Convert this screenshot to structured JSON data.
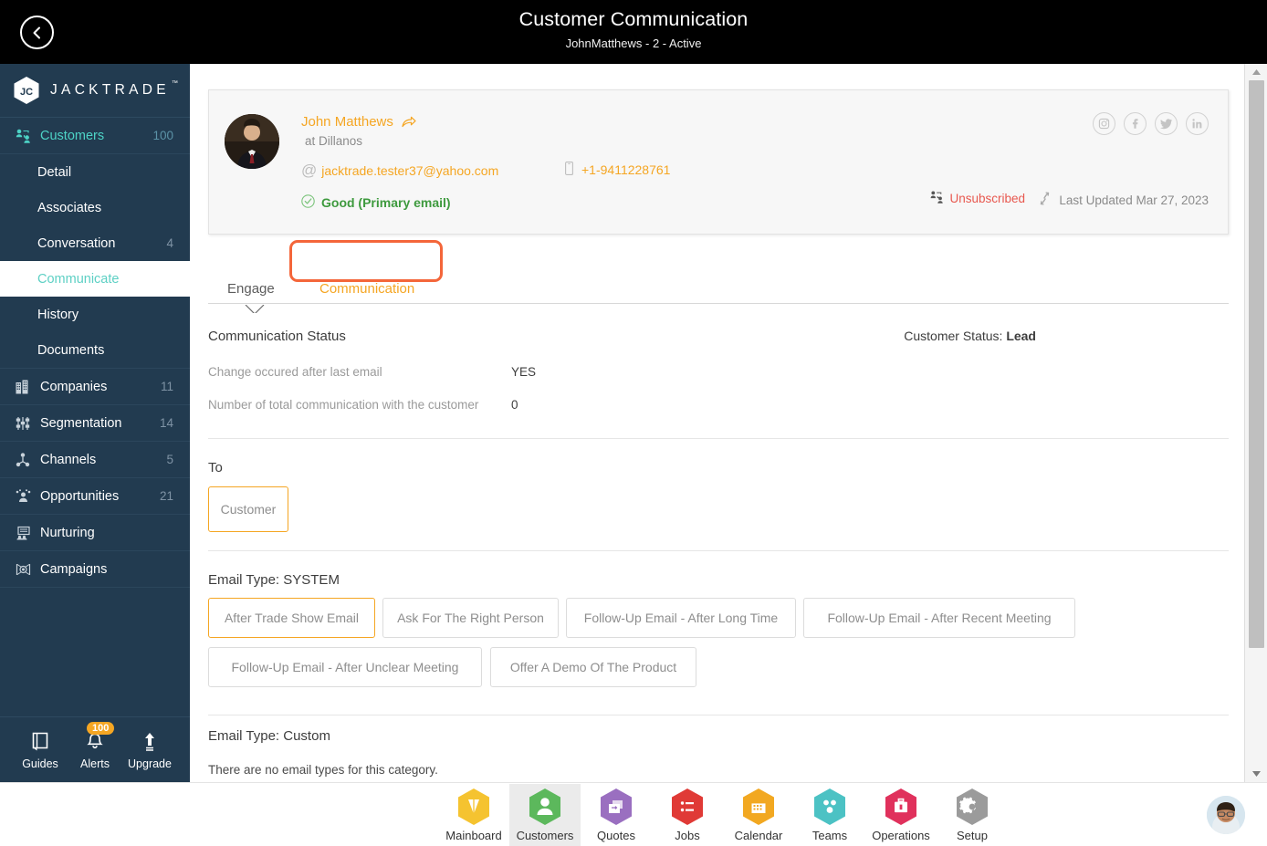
{
  "header": {
    "title": "Customer Communication",
    "subtitle": "JohnMatthews - 2 - Active",
    "back_icon": "back-arrow-circle-icon"
  },
  "sidebar": {
    "brand": "JACKTRADE",
    "brand_tm": "™",
    "nav": [
      {
        "label": "Customers",
        "count": "100",
        "icon": "customers-icon",
        "accent": true
      },
      {
        "label": "Companies",
        "count": "11",
        "icon": "companies-icon",
        "accent": false
      },
      {
        "label": "Segmentation",
        "count": "14",
        "icon": "segmentation-icon",
        "accent": false
      },
      {
        "label": "Channels",
        "count": "5",
        "icon": "channels-icon",
        "accent": false
      },
      {
        "label": "Opportunities",
        "count": "21",
        "icon": "opportunities-icon",
        "accent": false
      },
      {
        "label": "Nurturing",
        "count": "",
        "icon": "nurturing-icon",
        "accent": false
      },
      {
        "label": "Campaigns",
        "count": "",
        "icon": "campaigns-icon",
        "accent": false
      }
    ],
    "sub": [
      {
        "label": "Detail",
        "count": ""
      },
      {
        "label": "Associates",
        "count": ""
      },
      {
        "label": "Conversation",
        "count": "4"
      },
      {
        "label": "Communicate",
        "count": ""
      },
      {
        "label": "History",
        "count": ""
      },
      {
        "label": "Documents",
        "count": ""
      }
    ],
    "tools": [
      {
        "label": "Guides",
        "icon": "book-icon",
        "badge": ""
      },
      {
        "label": "Alerts",
        "icon": "bell-icon",
        "badge": "100"
      },
      {
        "label": "Upgrade",
        "icon": "up-arrow-icon",
        "badge": ""
      }
    ],
    "quick_icons": [
      "person-hex-icon",
      "dollar-hex-icon",
      "payment-hex-icon",
      "workflow-hex-icon"
    ]
  },
  "profile": {
    "name": "John Matthews",
    "company": "at Dillanos",
    "email": "jacktrade.tester37@yahoo.com",
    "phone": "+1-9411228761",
    "email_status": "Good (Primary email)",
    "unsubscribed": "Unsubscribed",
    "last_updated": "Last Updated Mar 27, 2023",
    "socials": [
      {
        "name": "instagram-icon",
        "glyph": "▣"
      },
      {
        "name": "facebook-icon",
        "glyph": "f"
      },
      {
        "name": "twitter-icon",
        "glyph": "ᵥ"
      },
      {
        "name": "linkedin-icon",
        "glyph": "in"
      }
    ]
  },
  "tabs": {
    "engage": "Engage",
    "communication": "Communication",
    "active": "Engage",
    "annotated": "Communication"
  },
  "comm_status": {
    "heading": "Communication Status",
    "customer_status_label": "Customer Status:",
    "customer_status_value": "Lead",
    "rows": [
      {
        "key": "Change occured after last email",
        "value": "YES"
      },
      {
        "key": "Number of total communication with the customer",
        "value": "0"
      }
    ]
  },
  "to_section": {
    "label": "To",
    "option": "Customer"
  },
  "email_system": {
    "heading": "Email Type: SYSTEM",
    "options": [
      {
        "label": "After Trade Show Email",
        "selected": true
      },
      {
        "label": "Ask For The Right Person",
        "selected": false
      },
      {
        "label": "Follow-Up Email - After Long Time",
        "selected": false
      },
      {
        "label": "Follow-Up Email - After Recent Meeting",
        "selected": false
      },
      {
        "label": "Follow-Up Email - After Unclear Meeting",
        "selected": false
      },
      {
        "label": "Offer A Demo Of The Product",
        "selected": false
      }
    ]
  },
  "email_custom": {
    "heading": "Email Type: Custom",
    "empty": "There are no email types for this category."
  },
  "bottom_nav": [
    {
      "label": "Mainboard",
      "color": "#f5c330",
      "icon": "mainboard-icon",
      "active": false
    },
    {
      "label": "Customers",
      "color": "#5cb85c",
      "icon": "customers-icon",
      "active": true
    },
    {
      "label": "Quotes",
      "color": "#9a6fc0",
      "icon": "quotes-icon",
      "active": false
    },
    {
      "label": "Jobs",
      "color": "#e03a36",
      "icon": "jobs-icon",
      "active": false
    },
    {
      "label": "Calendar",
      "color": "#f2a821",
      "icon": "calendar-icon",
      "active": false
    },
    {
      "label": "Teams",
      "color": "#4cc2c4",
      "icon": "teams-icon",
      "active": false
    },
    {
      "label": "Operations",
      "color": "#e0315c",
      "icon": "operations-icon",
      "active": false
    },
    {
      "label": "Setup",
      "color": "#9b9b9b",
      "icon": "gear-icon",
      "active": false
    }
  ],
  "colors": {
    "sidebar": "#223b50",
    "accent_orange": "#f5a623",
    "annotation": "#f4663a",
    "teal": "#4dd3c6",
    "good_green": "#3e9a3e",
    "unsub_red": "#e8584f"
  }
}
